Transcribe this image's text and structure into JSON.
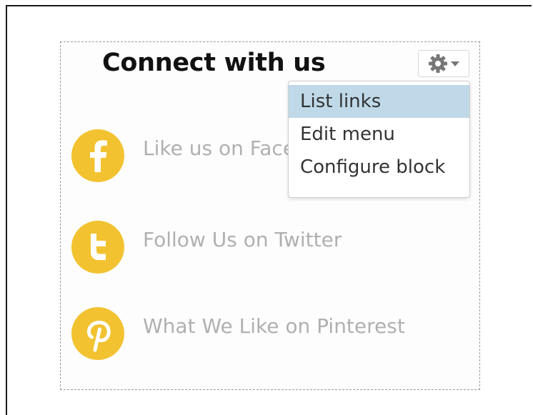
{
  "block": {
    "title": "Connect with us"
  },
  "actions_menu": {
    "items": [
      {
        "label": "List links",
        "active": true
      },
      {
        "label": "Edit menu",
        "active": false
      },
      {
        "label": "Configure block",
        "active": false
      }
    ]
  },
  "social_links": [
    {
      "label": "Like us on Facebook",
      "icon": "facebook-icon"
    },
    {
      "label": "Follow Us on Twitter",
      "icon": "twitter-icon"
    },
    {
      "label": "What We Like on Pinterest",
      "icon": "pinterest-icon"
    }
  ],
  "colors": {
    "icon_circle": "#f2c230",
    "link_text": "#b0b0b0",
    "menu_highlight": "#bfd9e8"
  }
}
